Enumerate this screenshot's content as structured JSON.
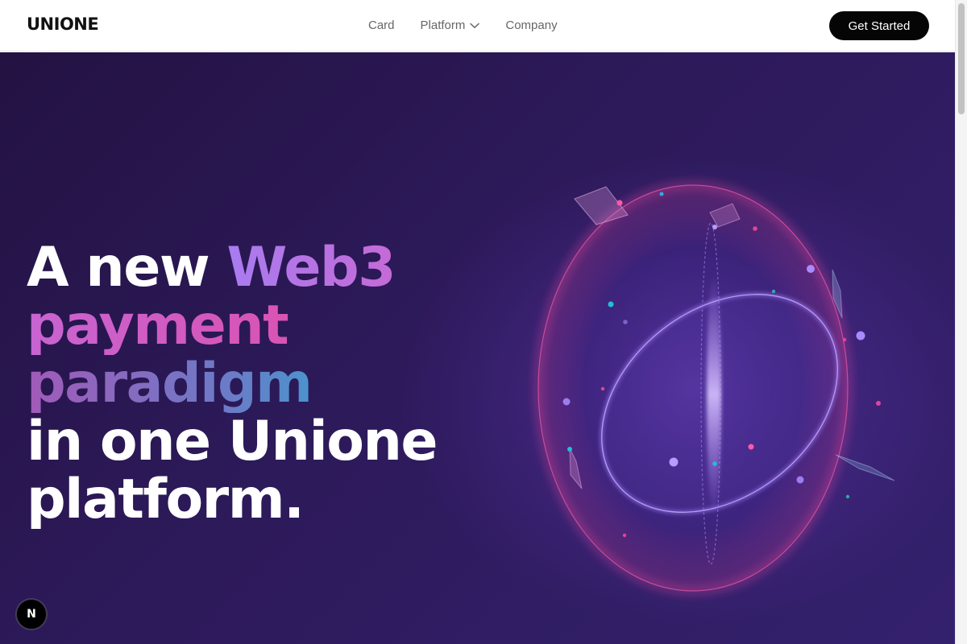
{
  "header": {
    "logo": "UNIONE",
    "nav": {
      "card": "Card",
      "platform": "Platform",
      "company": "Company"
    },
    "cta_label": "Get Started"
  },
  "hero": {
    "line1_plain": "A new ",
    "line1_accent": "Web3",
    "line2": "payment",
    "line3": "paradigm",
    "line4": "in one Unione",
    "line5": "platform."
  },
  "icons": {
    "chevron": "chevron-down-icon",
    "badge": "nextjs-logo-icon"
  },
  "badge_letter": "N",
  "colors": {
    "cta_bg": "#050505",
    "hero_bg": "#2c1958",
    "accent_purple": "#a87cf0",
    "accent_pink": "#e24aa2",
    "accent_cyan": "#19b8d4"
  }
}
